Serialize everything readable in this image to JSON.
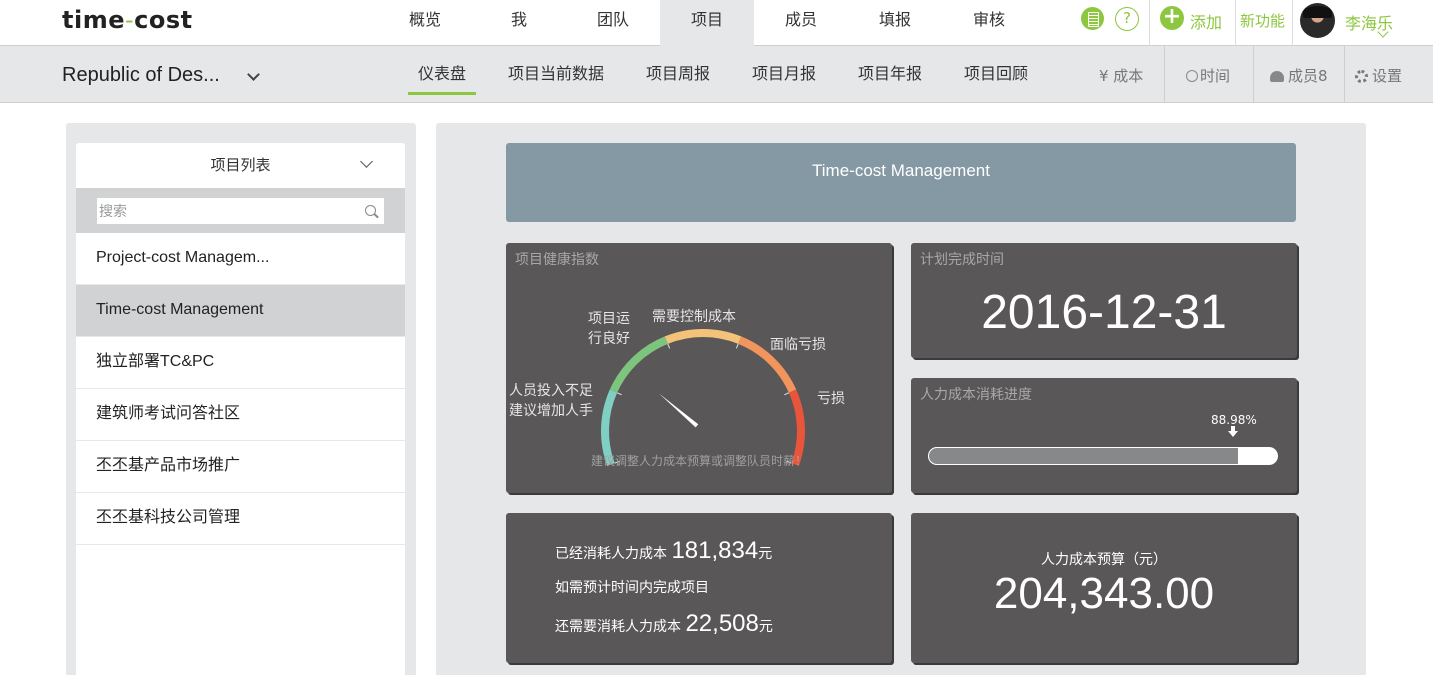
{
  "app": {
    "logo_pre": "time",
    "logo_dash": "-",
    "logo_post": "cost"
  },
  "topnav": {
    "items": [
      "概览",
      "我",
      "团队",
      "项目",
      "成员",
      "填报",
      "审核"
    ],
    "active": "项目",
    "help_glyph": "?",
    "add_glyph": "+",
    "add_label": "添加",
    "new_features": "新功能",
    "user_name": "李海乐"
  },
  "subnav": {
    "project_title": "Republic of Des...",
    "tabs": [
      "仪表盘",
      "项目当前数据",
      "项目周报",
      "项目月报",
      "项目年报",
      "项目回顾"
    ],
    "active": "仪表盘",
    "cost_label": "¥ 成本",
    "time_label": "时间",
    "members_label": "成员8",
    "settings_label": "设置"
  },
  "project_list": {
    "header": "项目列表",
    "search_placeholder": "搜索",
    "items": [
      "Project-cost Managem...",
      "Time-cost Management",
      "独立部署TC&PC",
      "建筑师考试问答社区",
      "丕丕基产品市场推广",
      "丕丕基科技公司管理"
    ],
    "selected_index": 1
  },
  "dashboard": {
    "banner_title": "Time-cost Management",
    "health": {
      "title": "项目健康指数",
      "labels": {
        "staffing_line1": "人员投入不足",
        "staffing_line2": "建议增加人手",
        "good_line1": "项目运",
        "good_line2": "行良好",
        "control": "需要控制成本",
        "facing_loss": "面临亏损",
        "loss": "亏损"
      },
      "hint": "建议调整人力成本预算或调整队员时薪！",
      "needle_value": 0.275,
      "segment_colors": [
        "#7fcfc3",
        "#7dc47e",
        "#f3c37a",
        "#f1955c",
        "#e8553b"
      ]
    },
    "planned_completion": {
      "title": "计划完成时间",
      "date": "2016-12-31"
    },
    "labor_progress": {
      "title": "人力成本消耗进度",
      "percent_label": "88.98%",
      "percent": 88.98
    },
    "cost_summary": {
      "spent_label": "已经消耗人力成本",
      "spent_value": "181,834",
      "unit": "元",
      "forecast_label": "如需预计时间内完成项目",
      "remaining_label": "还需要消耗人力成本",
      "remaining_value": "22,508"
    },
    "budget": {
      "label": "人力成本预算（元）",
      "value": "204,343.00"
    }
  },
  "colors": {
    "brand_green": "#8dc63f",
    "banner_blue": "#8599a5",
    "card_dark": "#595757"
  }
}
